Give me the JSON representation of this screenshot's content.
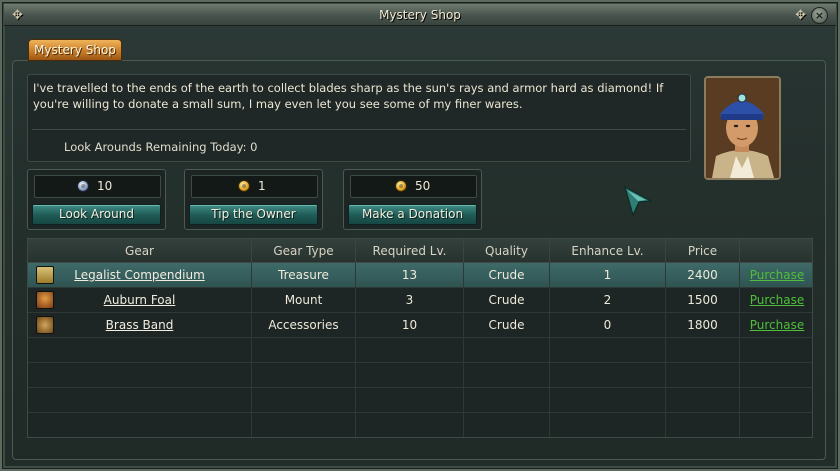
{
  "window": {
    "title": "Mystery Shop",
    "tab_label": "Mystery Shop",
    "corner_left": "✥",
    "corner_right": "✥",
    "close_glyph": "×"
  },
  "merchant": {
    "description": "I've travelled to the ends of the earth to collect blades sharp as the sun's rays and armor hard as diamond! If you're willing to donate a small sum, I may even let you see some of my finer wares.",
    "look_arounds_label": "Look Arounds Remaining Today:",
    "look_arounds_value": "0",
    "portrait_icon": "merchant-portrait"
  },
  "actions": [
    {
      "count": "10",
      "coin": "silver-coin-icon",
      "label": "Look Around"
    },
    {
      "count": "1",
      "coin": "gold-coin-icon",
      "label": "Tip the Owner"
    },
    {
      "count": "50",
      "coin": "gold-coin-icon",
      "label": "Make a Donation"
    }
  ],
  "table": {
    "headers": [
      "Gear",
      "Gear Type",
      "Required Lv.",
      "Quality",
      "Enhance Lv.",
      "Price",
      ""
    ],
    "rows": [
      {
        "icon": "book-icon",
        "name": "Legalist Compendium",
        "type": "Treasure",
        "req_lv": "13",
        "quality": "Crude",
        "enhance": "1",
        "price": "2400",
        "action": "Purchase",
        "selected": true
      },
      {
        "icon": "horse-icon",
        "name": "Auburn Foal",
        "type": "Mount",
        "req_lv": "3",
        "quality": "Crude",
        "enhance": "2",
        "price": "1500",
        "action": "Purchase",
        "selected": false
      },
      {
        "icon": "band-icon",
        "name": "Brass Band",
        "type": "Accessories",
        "req_lv": "10",
        "quality": "Crude",
        "enhance": "0",
        "price": "1800",
        "action": "Purchase",
        "selected": false
      }
    ]
  },
  "colors": {
    "accent_teal": "#2f5452",
    "tab_orange": "#c67b26",
    "link_green": "#4fbf3a"
  }
}
